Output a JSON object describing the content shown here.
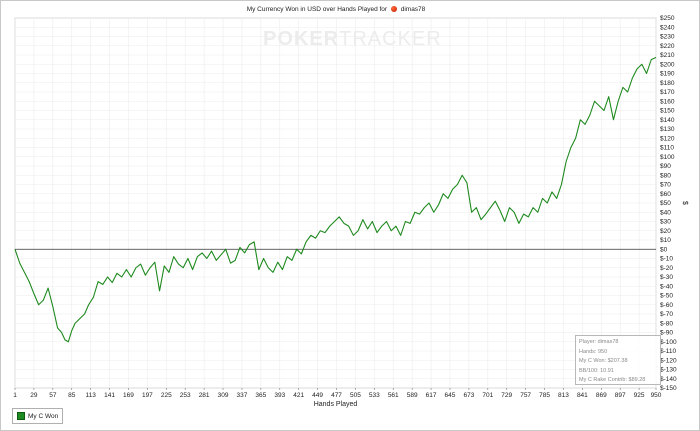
{
  "header": {
    "title_prefix": "My Currency Won in USD over Hands Played for",
    "player_name": "dimas78",
    "player_icon": "pokerstars-player-icon"
  },
  "watermark": {
    "bold_part": "POKER",
    "light_part": "TRACKER"
  },
  "stats_box": {
    "lines": [
      "Player: dimas78",
      "Hands: 950",
      "My C Won: $207.38",
      "BB/100: 10.91",
      "My C Rake Contrib: $89.28"
    ]
  },
  "legend": {
    "entries": [
      {
        "label": "My C Won",
        "color": "#1f8a1f"
      }
    ]
  },
  "chart_data": {
    "type": "line",
    "title": "My Currency Won in USD over Hands Played for dimas78",
    "xlabel": "Hands Played",
    "ylabel": "$",
    "xlim": [
      1,
      950
    ],
    "ylim": [
      -150,
      250
    ],
    "x_ticks": [
      1,
      29,
      57,
      85,
      113,
      141,
      169,
      197,
      225,
      253,
      281,
      309,
      337,
      365,
      393,
      421,
      449,
      477,
      505,
      533,
      561,
      589,
      617,
      645,
      673,
      701,
      729,
      757,
      785,
      813,
      841,
      869,
      897,
      925,
      950
    ],
    "y_ticks": [
      -150,
      -140,
      -130,
      -120,
      -110,
      -100,
      -90,
      -80,
      -70,
      -60,
      -50,
      -40,
      -30,
      -20,
      -10,
      0,
      10,
      20,
      30,
      40,
      50,
      60,
      70,
      80,
      90,
      100,
      110,
      120,
      130,
      140,
      150,
      160,
      170,
      180,
      190,
      200,
      210,
      220,
      230,
      240,
      250
    ],
    "y_tick_labels": [
      "$-150",
      "$-140",
      "$-130",
      "$-120",
      "$-110",
      "$-100",
      "$-90",
      "$-80",
      "$-70",
      "$-60",
      "$-50",
      "$-40",
      "$-30",
      "$-20",
      "$-10",
      "$0",
      "$10",
      "$20",
      "$30",
      "$40",
      "$50",
      "$60",
      "$70",
      "$80",
      "$90",
      "$100",
      "$110",
      "$120",
      "$130",
      "$140",
      "$150",
      "$160",
      "$170",
      "$180",
      "$190",
      "$200",
      "$210",
      "$220",
      "$230",
      "$240",
      "$250"
    ],
    "grid": true,
    "zero_line": true,
    "legend_position": "bottom-left",
    "series": [
      {
        "name": "My C Won",
        "color": "#1f8a1f",
        "x": [
          1,
          8,
          15,
          22,
          29,
          36,
          43,
          50,
          57,
          64,
          70,
          75,
          80,
          85,
          90,
          97,
          104,
          110,
          117,
          124,
          131,
          138,
          145,
          152,
          159,
          166,
          173,
          180,
          187,
          194,
          201,
          208,
          215,
          222,
          229,
          236,
          243,
          250,
          257,
          264,
          271,
          278,
          285,
          292,
          299,
          306,
          313,
          320,
          327,
          334,
          341,
          348,
          355,
          362,
          369,
          376,
          383,
          390,
          397,
          404,
          411,
          418,
          425,
          432,
          439,
          446,
          453,
          460,
          467,
          474,
          481,
          488,
          495,
          502,
          509,
          516,
          523,
          530,
          537,
          544,
          551,
          558,
          565,
          572,
          579,
          586,
          593,
          600,
          607,
          614,
          621,
          628,
          635,
          642,
          649,
          656,
          663,
          670,
          677,
          684,
          691,
          698,
          705,
          712,
          719,
          726,
          733,
          740,
          747,
          754,
          761,
          768,
          775,
          782,
          789,
          796,
          803,
          810,
          817,
          824,
          831,
          838,
          845,
          852,
          859,
          866,
          873,
          880,
          887,
          894,
          901,
          908,
          915,
          922,
          929,
          936,
          943,
          950
        ],
        "y": [
          0,
          -15,
          -25,
          -35,
          -48,
          -60,
          -55,
          -42,
          -62,
          -85,
          -90,
          -98,
          -100,
          -88,
          -80,
          -75,
          -70,
          -60,
          -52,
          -35,
          -38,
          -30,
          -36,
          -26,
          -30,
          -22,
          -30,
          -20,
          -16,
          -28,
          -20,
          -14,
          -45,
          -18,
          -25,
          -8,
          -16,
          -20,
          -10,
          -22,
          -8,
          -4,
          -10,
          -2,
          -12,
          -6,
          0,
          -15,
          -12,
          2,
          -4,
          5,
          8,
          -22,
          -10,
          -20,
          -25,
          -14,
          -22,
          -8,
          -12,
          0,
          -5,
          8,
          15,
          12,
          20,
          18,
          25,
          30,
          35,
          28,
          25,
          15,
          20,
          32,
          22,
          30,
          18,
          25,
          30,
          20,
          25,
          15,
          30,
          28,
          40,
          38,
          45,
          50,
          40,
          48,
          60,
          55,
          65,
          70,
          80,
          72,
          40,
          45,
          32,
          38,
          45,
          52,
          42,
          30,
          45,
          40,
          28,
          38,
          35,
          45,
          40,
          55,
          50,
          62,
          55,
          70,
          95,
          110,
          120,
          140,
          135,
          145,
          160,
          155,
          150,
          165,
          140,
          160,
          175,
          170,
          185,
          195,
          200,
          190,
          205,
          207.38
        ]
      }
    ]
  }
}
